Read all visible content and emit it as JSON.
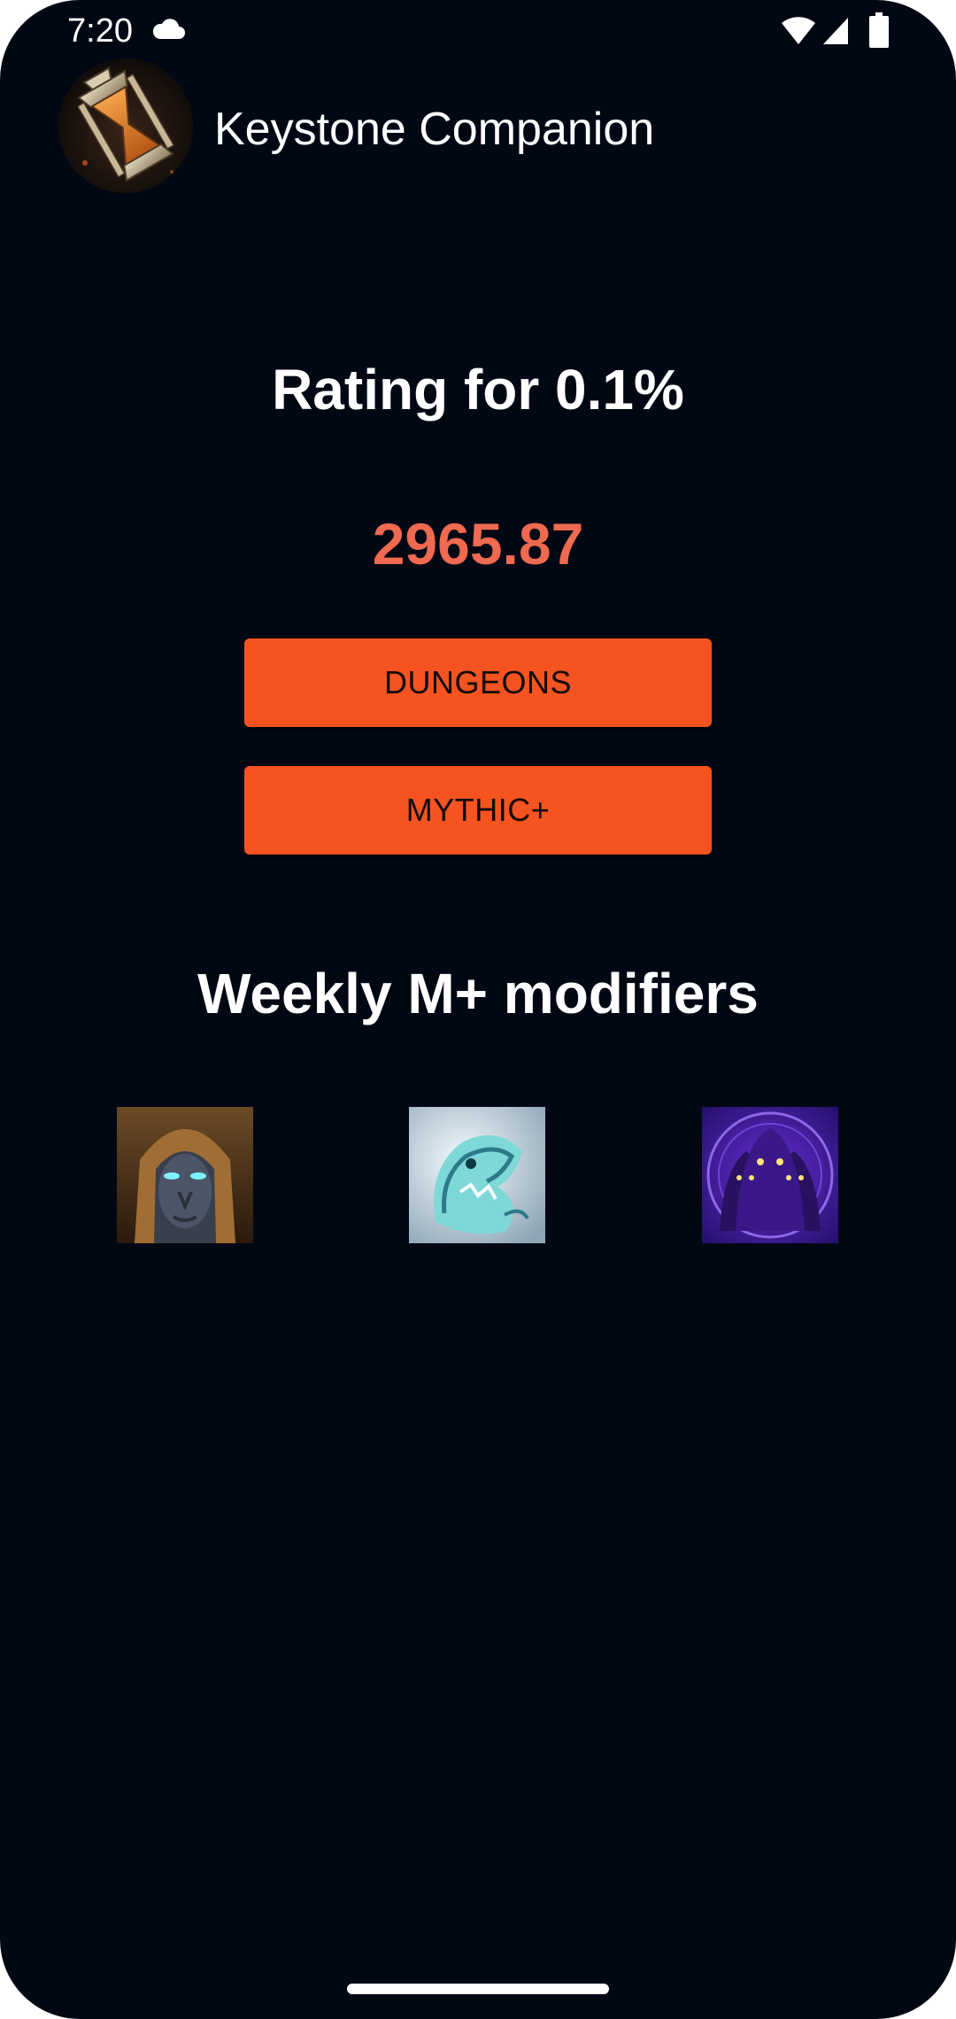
{
  "status_bar": {
    "time": "7:20",
    "icons": [
      "cloud-icon",
      "wifi-icon",
      "signal-icon",
      "battery-icon"
    ]
  },
  "app": {
    "title": "Keystone Companion",
    "logo_icon": "keystone-hourglass-icon"
  },
  "rating": {
    "heading": "Rating for 0.1%",
    "value": "2965.87"
  },
  "buttons": {
    "dungeons_label": "DUNGEONS",
    "mythic_label": "MYTHIC+"
  },
  "modifiers": {
    "heading": "Weekly M+ modifiers",
    "items": [
      {
        "icon": "hooded-stone-face-icon"
      },
      {
        "icon": "frost-creature-icon"
      },
      {
        "icon": "purple-hooded-figures-icon"
      }
    ]
  },
  "colors": {
    "background": "#010814",
    "accent": "#f55421",
    "rating_value": "#ef6a50",
    "text": "#ffffff"
  }
}
